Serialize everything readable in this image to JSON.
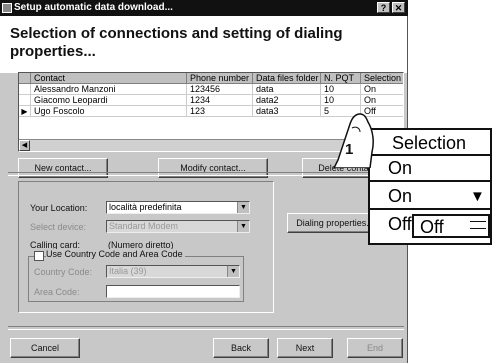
{
  "window": {
    "title": "Setup automatic data download...",
    "help_glyph": "?",
    "close_glyph": "✕"
  },
  "heading": "Selection of connections and setting of dialing properties...",
  "grid": {
    "columns": [
      "Contact",
      "Phone number",
      "Data files folder",
      "N. PQT",
      "Selection"
    ],
    "rows": [
      {
        "contact": "Alessandro Manzoni",
        "phone": "123456",
        "folder": "data",
        "pqt": "10",
        "selection": "On",
        "current": false
      },
      {
        "contact": "Giacomo Leopardi",
        "phone": "1234",
        "folder": "data2",
        "pqt": "10",
        "selection": "On",
        "current": false
      },
      {
        "contact": "Ugo Foscolo",
        "phone": "123",
        "folder": "data3",
        "pqt": "5",
        "selection": "Off",
        "current": true
      }
    ],
    "current_row_marker": "▶"
  },
  "buttons": {
    "new_contact": "New contact...",
    "modify_contact": "Modify contact...",
    "delete_contact": "Delete contact",
    "dialing_properties": "Dialing properties...",
    "cancel": "Cancel",
    "back": "Back",
    "next": "Next",
    "end": "End"
  },
  "location": {
    "your_location_label": "Your Location:",
    "your_location_value": "località predefinita",
    "select_device_label": "Select device:",
    "select_device_value": "Standard Modem",
    "calling_card_label": "Calling card:",
    "calling_card_value": "(Numero diretto)",
    "use_country_code_label": "Use Country Code and Area Code",
    "country_code_label": "Country Code:",
    "country_code_value": "Italia (39)",
    "area_code_label": "Area Code:",
    "area_code_value": ""
  },
  "callout": {
    "header": "Selection",
    "cell_on": "On",
    "combo_value": "On",
    "off_cell": "Off",
    "dropdown_option": "Off",
    "step_number": "1"
  }
}
